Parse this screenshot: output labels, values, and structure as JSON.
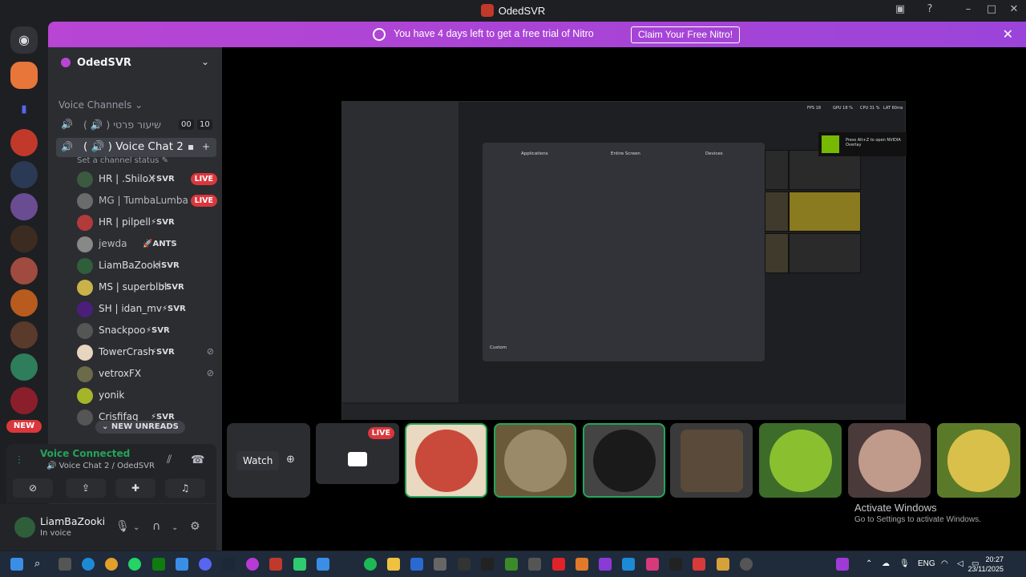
{
  "window": {
    "title": "OdedSVR"
  },
  "nitro": {
    "message": "You have 4 days left to get a free trial of Nitro",
    "claim_label": "Claim Your Free Nitro!"
  },
  "servers": {
    "new_label": "NEW"
  },
  "guild": {
    "name": "OdedSVR"
  },
  "channels": {
    "category": "Voice Channels",
    "items": [
      {
        "label": "( 🔊 ) שיעור פרטי",
        "count_a": "00",
        "count_b": "10"
      },
      {
        "label": "( 🔊 ) Voice Chat 2"
      }
    ],
    "status_placeholder": "Set a channel status",
    "users": [
      {
        "name": "HR | .ShiloX",
        "tag": "⚡SVR",
        "live": "LIVE"
      },
      {
        "name": "MG | TumbaLumba",
        "tag": "",
        "live": "LIVE"
      },
      {
        "name": "HR | pilpell",
        "tag": "⚡SVR"
      },
      {
        "name": "jewda",
        "tag": "🚀ANTS"
      },
      {
        "name": "LiamBaZooki",
        "tag": "⚡SVR"
      },
      {
        "name": "MS | superblbl",
        "tag": "⚡SVR"
      },
      {
        "name": "SH | idan_mv",
        "tag": "⚡SVR"
      },
      {
        "name": "Snackpoo",
        "tag": "⚡SVR"
      },
      {
        "name": "TowerCrash",
        "tag": "⚡SVR"
      },
      {
        "name": "vetroxFX",
        "tag": ""
      },
      {
        "name": "yonik",
        "tag": ""
      },
      {
        "name": "Crisfifag",
        "tag": "⚡SVR"
      }
    ],
    "new_unreads": "NEW UNREADS"
  },
  "voice": {
    "status": "Voice Connected",
    "location": "Voice Chat 2 / OdedSVR"
  },
  "me": {
    "name": "LiamBaZooki",
    "status": "In voice"
  },
  "stage": {
    "watch_label": "Watch",
    "live_label": "LIVE",
    "mini": {
      "tab_apps": "Applications",
      "tab_screen": "Entire Screen",
      "tab_devices": "Devices",
      "custom": "Custom",
      "nvidia": "Press Alt+Z to open NVIDIA Overlay",
      "fps": "FPS 18",
      "gpu": "GPU 18 %",
      "cpu": "CPU 31 %",
      "lat": "LAT 60ms"
    }
  },
  "activation": {
    "title": "Activate Windows",
    "subtitle": "Go to Settings to activate Windows."
  },
  "taskbar": {
    "lang": "ENG",
    "time": "20:27",
    "date": "23/11/2025"
  }
}
